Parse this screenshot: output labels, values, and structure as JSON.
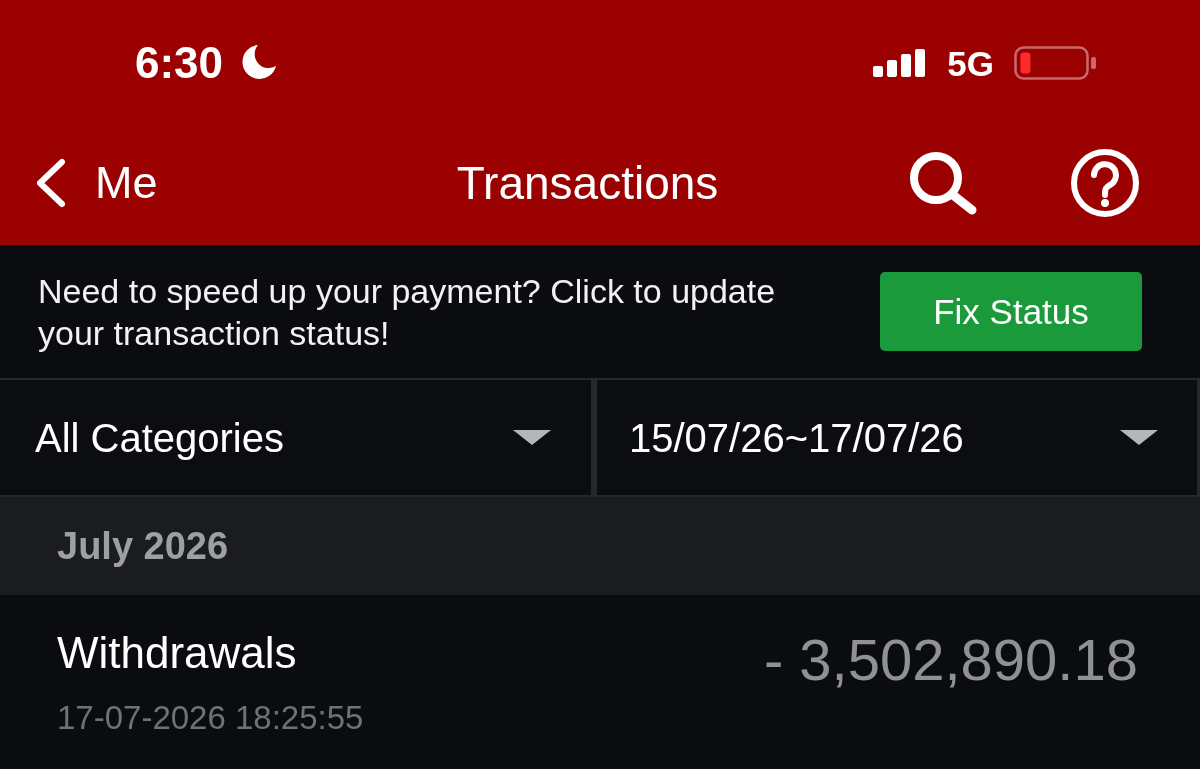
{
  "status_bar": {
    "time": "6:30",
    "network": "5G"
  },
  "nav": {
    "back_label": "Me",
    "title": "Transactions"
  },
  "banner": {
    "message": "Need to speed up your payment? Click to update your transaction status!",
    "button": "Fix Status"
  },
  "filters": [
    {
      "value": "All Categories"
    },
    {
      "value": "15/07/26~17/07/26"
    }
  ],
  "sections": [
    {
      "heading": "July 2026",
      "transactions": [
        {
          "type": "Withdrawals",
          "datetime": "17-07-2026 18:25:55",
          "amount": "- 3,502,890.18"
        }
      ]
    }
  ]
}
